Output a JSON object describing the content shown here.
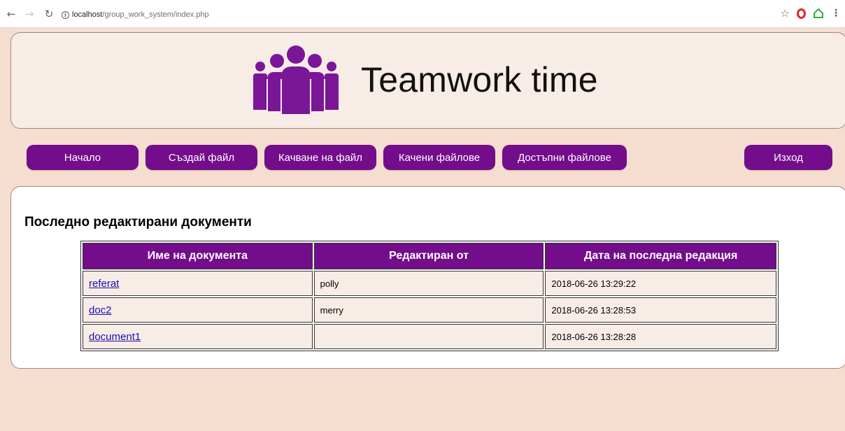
{
  "browser": {
    "url_host": "localhost",
    "url_path": "/group_work_system/index.php"
  },
  "header": {
    "title": "Teamwork time",
    "logo_icon": "team-people-icon",
    "logo_color": "#7b1696"
  },
  "menu": {
    "items": [
      {
        "label": "Начало"
      },
      {
        "label": "Създай файл"
      },
      {
        "label": "Качване на файл"
      },
      {
        "label": "Качени файлове"
      },
      {
        "label": "Достъпни файлове"
      }
    ],
    "logout_label": "Изход",
    "button_color": "#730d8b"
  },
  "content": {
    "section_title": "Последно редактирани документи",
    "table": {
      "headers": [
        "Име на документа",
        "Редактиран от",
        "Дата на последна редакция"
      ],
      "rows": [
        {
          "name": "referat",
          "editor": "polly",
          "date": "2018-06-26 13:29:22"
        },
        {
          "name": "doc2",
          "editor": "merry",
          "date": "2018-06-26 13:28:53"
        },
        {
          "name": "document1",
          "editor": "",
          "date": "2018-06-26 13:28:28"
        }
      ]
    }
  },
  "colors": {
    "page_bg": "#f5ddd0",
    "panel_bg": "#f8ece7",
    "accent": "#730d8b",
    "link": "#1a0dab"
  }
}
